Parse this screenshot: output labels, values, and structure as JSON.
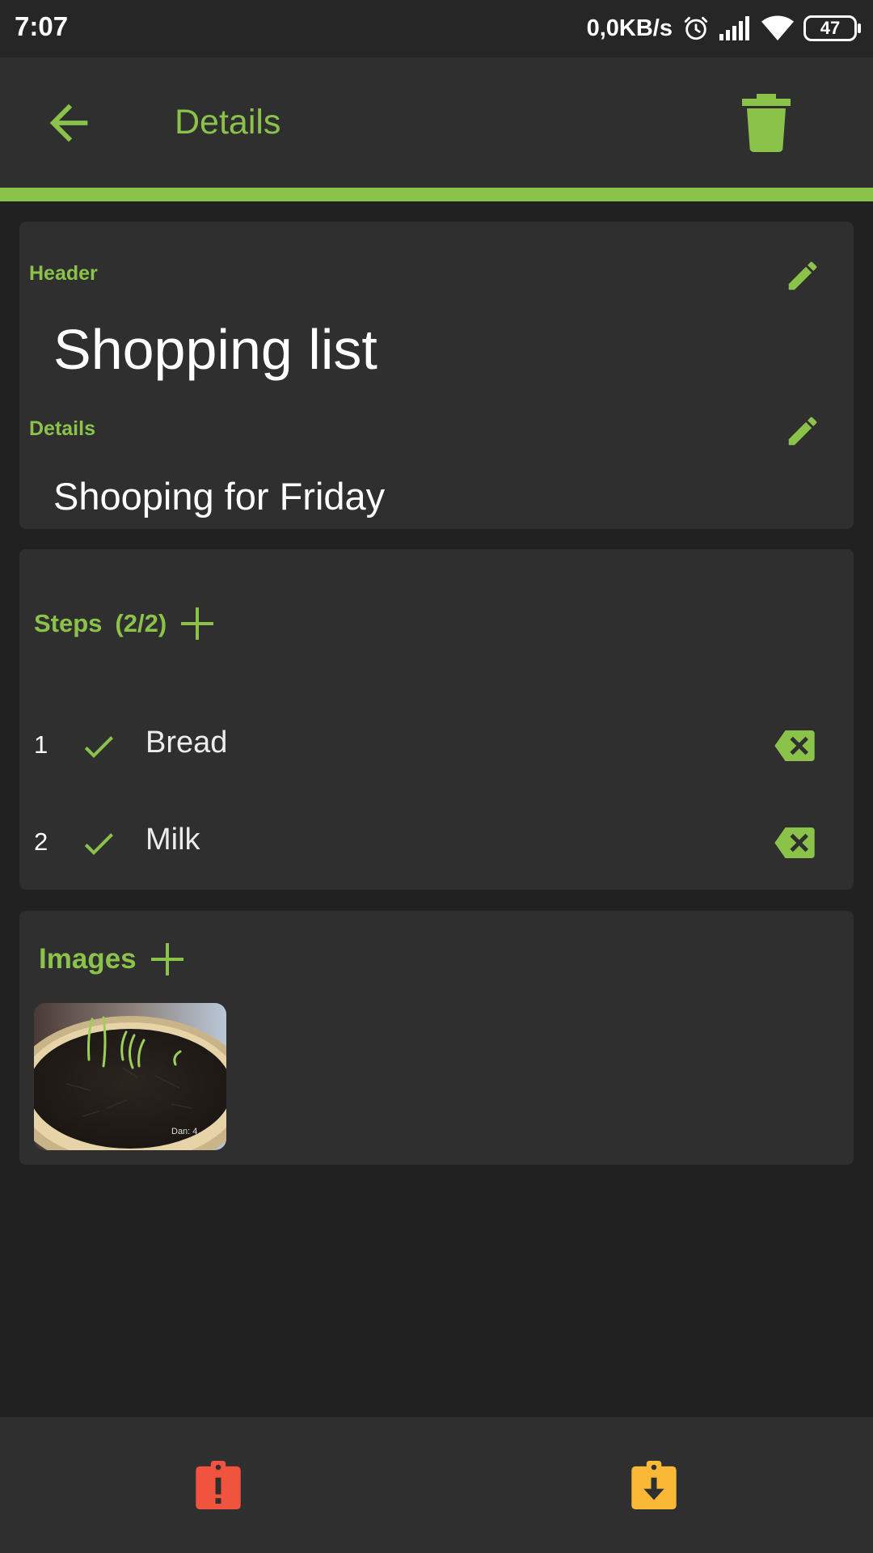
{
  "status_bar": {
    "time": "7:07",
    "network_speed": "0,0KB/s",
    "battery": "47",
    "icons": [
      "alarm-icon",
      "signal-icon",
      "wifi-icon",
      "battery-icon"
    ]
  },
  "app_bar": {
    "title": "Details",
    "back_icon": "arrow-back-icon",
    "delete_icon": "trash-icon"
  },
  "colors": {
    "accent": "#8bc34a",
    "background": "#212121",
    "surface": "#2f2f2f",
    "danger": "#f0533e",
    "warning": "#f9b936"
  },
  "header_card": {
    "header_label": "Header",
    "title": "Shopping list",
    "details_label": "Details",
    "details_text": "Shooping for Friday"
  },
  "steps_card": {
    "label": "Steps",
    "count": "(2/2)",
    "items": [
      {
        "number": "1",
        "text": "Bread",
        "done": true
      },
      {
        "number": "2",
        "text": "Milk",
        "done": true
      }
    ]
  },
  "images_card": {
    "label": "Images",
    "images": [
      {
        "caption": "Dan: 4"
      }
    ]
  },
  "bottom_bar": {
    "left_icon": "clipboard-alert-icon",
    "right_icon": "clipboard-download-icon"
  }
}
